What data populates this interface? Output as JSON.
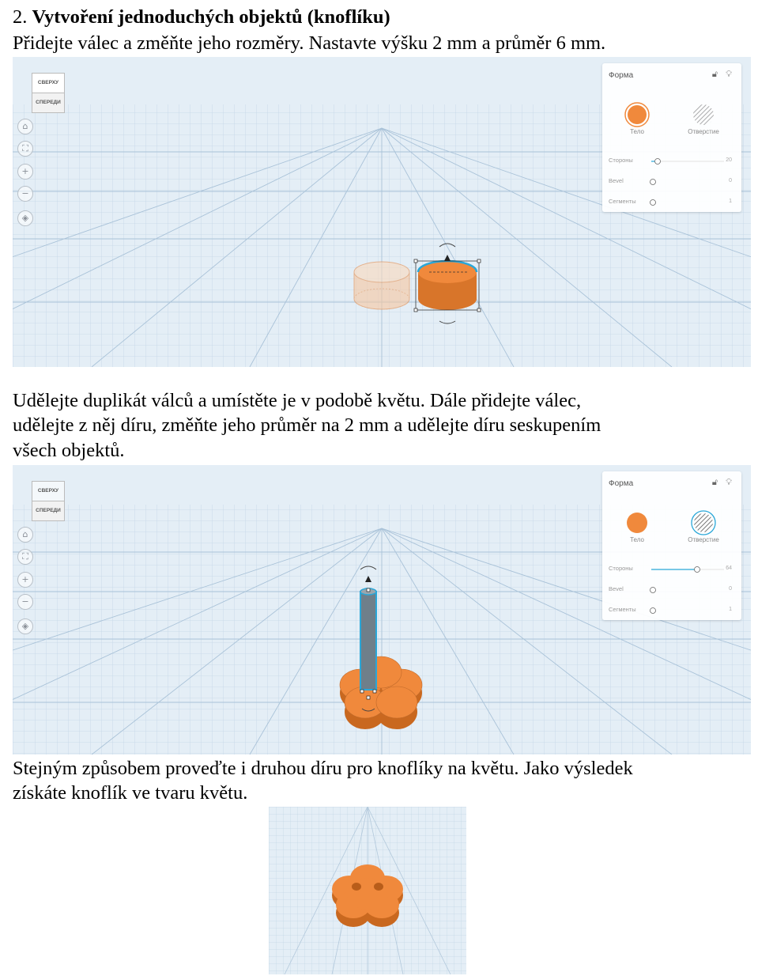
{
  "section": {
    "number": "2.",
    "title": "Vytvoření jednoduchých objektů (knoflíku)"
  },
  "paragraphs": {
    "p1": "Přidejte válec a změňte jeho rozměry. Nastavte výšku 2 mm a průměr 6 mm.",
    "p2_line1": "Udělejte duplikát válců a umístěte je v podobě květu. Dále přidejte válec,",
    "p2_line2": "udělejte z něj díru, změňte jeho průměr na 2 mm a udělejte díru seskupením",
    "p2_line3": "všech objektů.",
    "p3_line1": "Stejným způsobem proveďte i druhou díru pro knoflíky na květu. Jako výsledek",
    "p3_line2": "získáte knoflík ve tvaru květu."
  },
  "editor": {
    "viewcube_top": "СВЕРХУ",
    "viewcube_front": "СПЕРЕДИ",
    "nav_icons": [
      "home-icon",
      "fit-icon",
      "zoom-in-icon",
      "zoom-out-icon",
      "ortho-icon"
    ],
    "panel_title": "Форма",
    "body_label": "Тело",
    "hole_label": "Отверстие",
    "sides_label": "Стороны",
    "bevel_label": "Bevel",
    "segments_label": "Сегменты",
    "shot1": {
      "sides": "20",
      "sides_slider": 0.06,
      "bevel": "0",
      "segments": "1"
    },
    "shot2": {
      "sides": "64",
      "sides_slider": 0.6,
      "bevel": "0",
      "segments": "1"
    }
  },
  "colors": {
    "orange": "#f0893c",
    "orange_dark": "#c96a20",
    "grid_bg": "#dde9f3",
    "grid_line": "#b9cfe0",
    "selection": "#2aa7d8"
  }
}
